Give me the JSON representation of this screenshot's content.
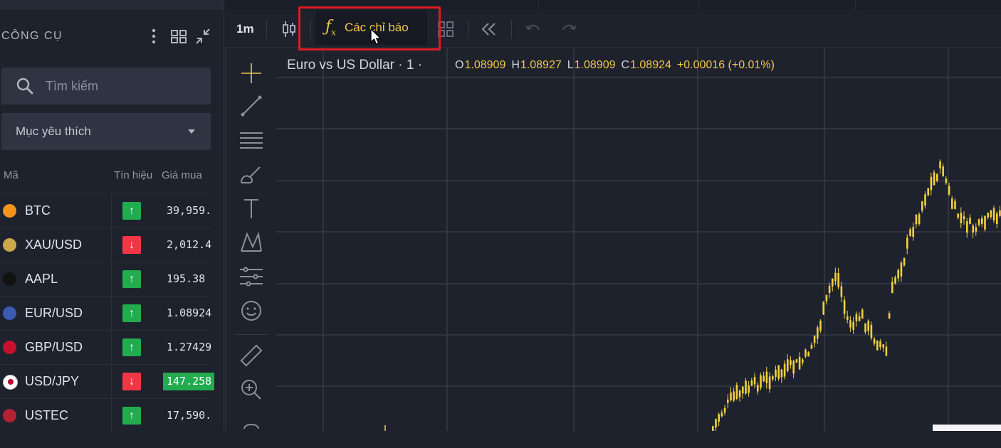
{
  "left_panel": {
    "title": "CÔNG CỤ",
    "search": {
      "placeholder": "Tìm kiếm"
    },
    "watchlist_select": {
      "selected": "Mục yêu thích"
    },
    "columns": {
      "symbol": "Mã",
      "signal": "Tín hiệu",
      "bid": "Giá mua"
    },
    "rows": [
      {
        "symbol": "BTC",
        "signal": "up",
        "price": "39,959.",
        "icon_color": "#f7931a",
        "highlight": false
      },
      {
        "symbol": "XAU/USD",
        "signal": "down",
        "price": "2,012.4",
        "icon_color": "#c9a94b",
        "highlight": false
      },
      {
        "symbol": "AAPL",
        "signal": "up",
        "price": "195.38",
        "icon_color": "#111111",
        "highlight": false
      },
      {
        "symbol": "EUR/USD",
        "signal": "up",
        "price": "1.08924",
        "icon_color": "#3b5bb5",
        "highlight": false
      },
      {
        "symbol": "GBP/USD",
        "signal": "up",
        "price": "1.27429",
        "icon_color": "#c8102e",
        "highlight": false
      },
      {
        "symbol": "USD/JPY",
        "signal": "down",
        "price": "147.258",
        "icon_color": "#ffffff",
        "highlight": true
      },
      {
        "symbol": "USTEC",
        "signal": "up",
        "price": "17,590.",
        "icon_color": "#b22234",
        "highlight": false
      }
    ]
  },
  "toolbar": {
    "timeframe": "1m",
    "indicators_label": "Các chỉ báo"
  },
  "legend": {
    "title": "Euro vs US Dollar · 1 ·",
    "open_label": "O",
    "open": "1.08909",
    "high_label": "H",
    "high": "1.08927",
    "low_label": "L",
    "low": "1.08909",
    "close_label": "C",
    "close": "1.08924",
    "change": "+0.00016 (+0.01%)"
  },
  "colors": {
    "background": "#1e222d",
    "candle": "#f0d13c",
    "signal_up": "#22ab4f",
    "signal_down": "#f23645",
    "highlight_box": "#e01b22",
    "accent_text": "#f0c84a"
  }
}
